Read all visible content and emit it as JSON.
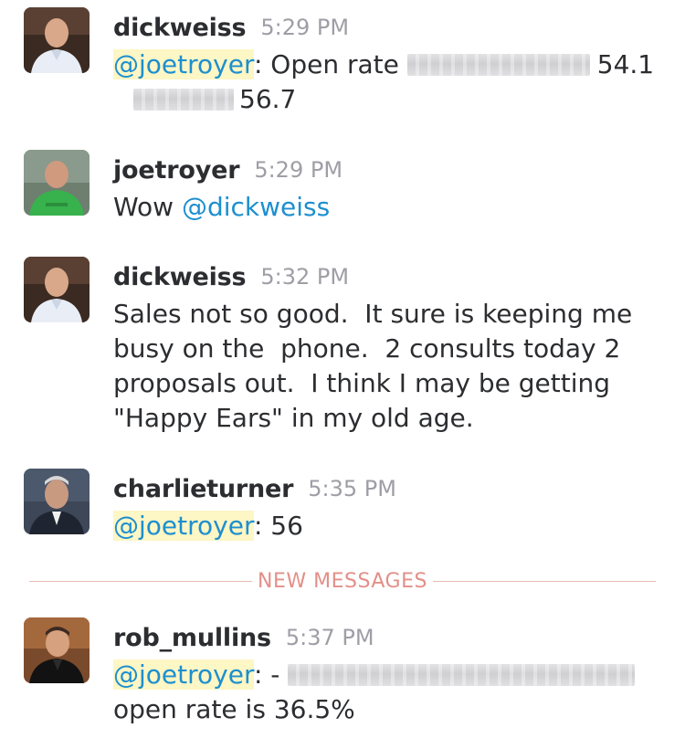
{
  "messages": [
    {
      "author": "dickweiss",
      "time": "5:29 PM",
      "mention": "@joetroyer",
      "text_a": ": Open rate ",
      "value_a": "54.1",
      "value_b": "56.7"
    },
    {
      "author": "joetroyer",
      "time": "5:29 PM",
      "text": "Wow ",
      "mention": "@dickweiss"
    },
    {
      "author": "dickweiss",
      "time": "5:32 PM",
      "lines": [
        "Sales not so good.  It sure is keeping me",
        "busy on the  phone.  2 consults today 2",
        "proposals out.  I think I may be getting",
        "\"Happy Ears\" in my old age."
      ]
    },
    {
      "author": "charlieturner",
      "time": "5:35 PM",
      "mention": "@joetroyer",
      "text": ": 56"
    },
    {
      "author": "rob_mullins",
      "time": "5:37 PM",
      "mention": "@joetroyer",
      "text_a": ": - ",
      "line2": "open rate is 36.5%"
    }
  ],
  "divider_label": "NEW MESSAGES",
  "colors": {
    "mention": "#1d8fcf",
    "mention_bg": "#fdf6c5",
    "timestamp": "#9e9ea6",
    "divider": "#e38f89"
  },
  "avatars": [
    "avatar-dickweiss",
    "avatar-joetroyer",
    "avatar-dickweiss",
    "avatar-charlieturner",
    "avatar-rob_mullins"
  ]
}
